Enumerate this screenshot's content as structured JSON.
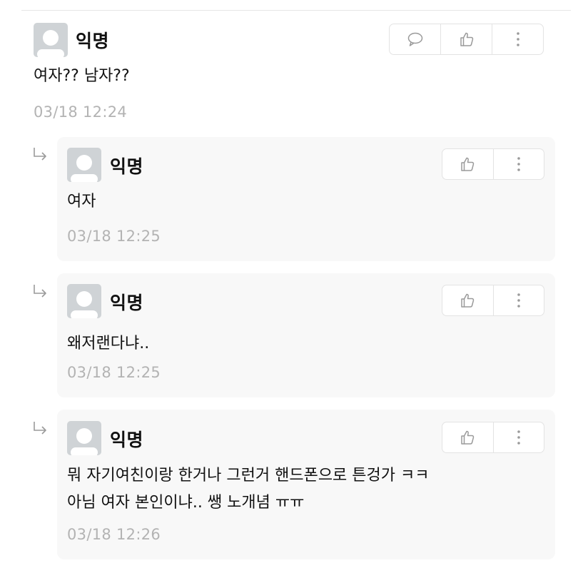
{
  "comment": {
    "author": "익명",
    "text": "여자?? 남자??",
    "time": "03/18 12:24",
    "icons": [
      "reply-icon",
      "thumbs-up-icon",
      "more-vertical-icon"
    ]
  },
  "replies": [
    {
      "author": "익명",
      "text_lines": [
        "여자"
      ],
      "time": "03/18 12:25"
    },
    {
      "author": "익명",
      "text_lines": [
        "왜저랜다냐.."
      ],
      "time": "03/18 12:25"
    },
    {
      "author": "익명",
      "text_lines": [
        "뭐 자기여친이랑 한거나 그런거 핸드폰으로 튼겅가 ㅋㅋ",
        "아님 여자 본인이냐.. 쌩 노개념 ㅠㅠ"
      ],
      "time": "03/18 12:26"
    }
  ],
  "colors": {
    "avatar_bg": "#cfd3d6",
    "reply_bg": "#f8f8f8",
    "timestamp": "#b3b3b3",
    "border": "#e3e3e3",
    "icon": "#9a9a9a"
  }
}
